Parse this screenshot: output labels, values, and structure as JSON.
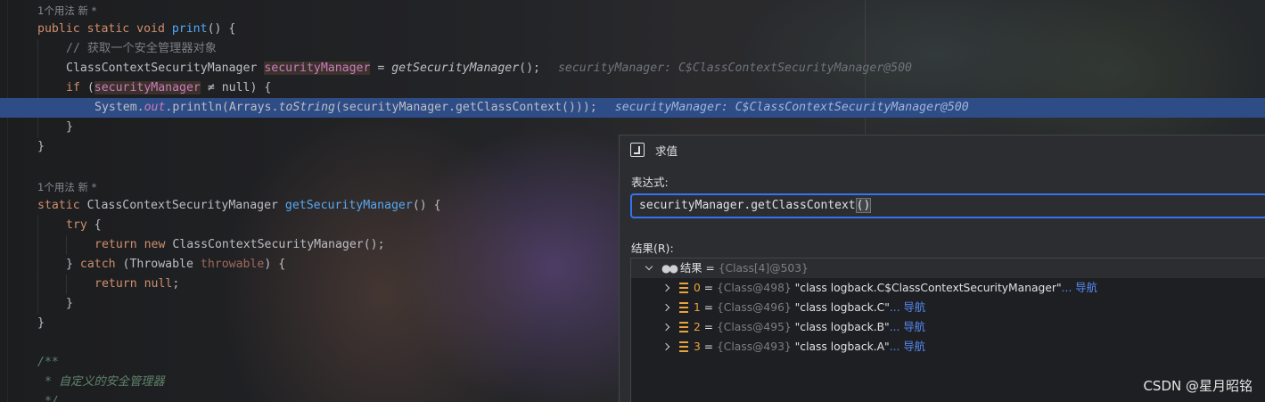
{
  "editor": {
    "usage_hint_1": "1个用法  新 *",
    "usage_hint_2": "1个用法  新 *",
    "code": {
      "l1": {
        "a": "public static void ",
        "fn": "print",
        "b": "() {"
      },
      "l2": {
        "cmt": "// 获取一个安全管理器对象"
      },
      "l3": {
        "a": "ClassContextSecurityManager ",
        "var": "securityManager",
        "b": " = ",
        "call": "getSecurityManager",
        "c": "();",
        "dbg": "securityManager: C$ClassContextSecurityManager@500"
      },
      "l4": {
        "kw": "if",
        "a": " (",
        "var": "securityManager",
        "b": " ≠ null) {"
      },
      "l5": {
        "a": "System.",
        "out": "out",
        "b": ".println(Arrays.",
        "ts": "toString",
        "c": "(securityManager.getClassContext()));",
        "dbg": "securityManager: C$ClassContextSecurityManager@500"
      },
      "l6": {
        "a": "}"
      },
      "l7": {
        "a": "}"
      },
      "l8": {
        "kw": "static ",
        "a": "ClassContextSecurityManager ",
        "fn": "getSecurityManager",
        "b": "() {"
      },
      "l9": {
        "kw": "try",
        "a": " {"
      },
      "l10": {
        "kw": "return new ",
        "a": "ClassContextSecurityManager();"
      },
      "l11": {
        "a": "} ",
        "kw": "catch",
        "b": " (Throwable ",
        "var": "throwable",
        "c": ") {"
      },
      "l12": {
        "kw": "return null",
        "a": ";"
      },
      "l13": {
        "a": "}"
      },
      "l14": {
        "a": "}"
      },
      "l15": {
        "a": "/**"
      },
      "l16": {
        "a": " * 自定义的安全管理器"
      },
      "l17": {
        "a": " */"
      }
    }
  },
  "dialog": {
    "title": "求值",
    "expression_label": "表达式:",
    "expression_value": "securityManager.getClassContext",
    "expression_paren": "()",
    "result_label": "结果(R):",
    "root": {
      "name": "结果",
      "eq": " = ",
      "type": "{Class[4]@503}"
    },
    "items": [
      {
        "index": "0",
        "type": "{Class@498}",
        "value": "\"class logback.C$ClassContextSecurityManager\"",
        "more": "...",
        "nav": "导航"
      },
      {
        "index": "1",
        "type": "{Class@496}",
        "value": "\"class logback.C\"",
        "more": "...",
        "nav": "导航"
      },
      {
        "index": "2",
        "type": "{Class@495}",
        "value": "\"class logback.B\"",
        "more": "...",
        "nav": "导航"
      },
      {
        "index": "3",
        "type": "{Class@493}",
        "value": "\"class logback.A\"",
        "more": "...",
        "nav": "导航"
      }
    ]
  },
  "watermark": "CSDN @星月昭铭",
  "colors": {
    "keyword": "#cf8e6d",
    "function": "#56a8f5",
    "field": "#c77dbb",
    "highlight_line": "#2e4c86",
    "link": "#548af7",
    "accent_border": "#3574f0"
  }
}
